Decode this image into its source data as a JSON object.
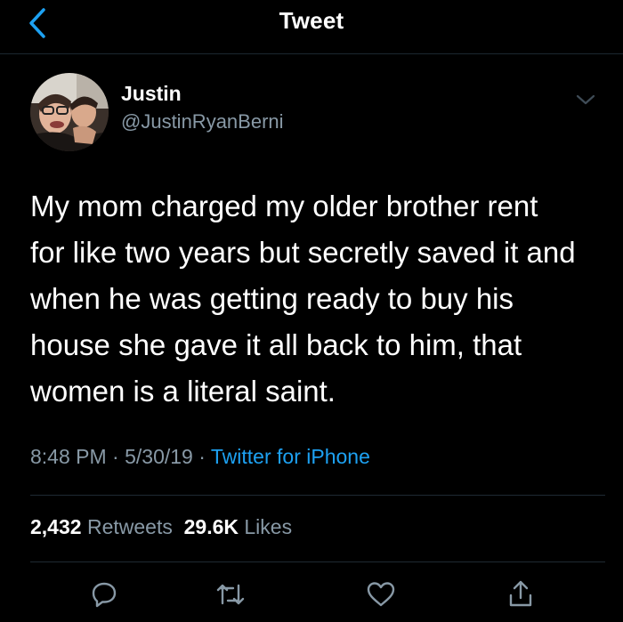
{
  "header": {
    "title": "Tweet",
    "back_icon": "chevron-left-icon"
  },
  "tweet": {
    "author": {
      "name": "Justin",
      "handle": "@JustinRyanBerni"
    },
    "lines": [
      "My mom charged my older brother rent",
      "for like two years but secretly saved it and",
      "when he was getting ready to buy his",
      "house she gave it all back to him, that",
      "women is a literal saint."
    ],
    "time": "8:48 PM",
    "date": "5/30/19",
    "separator": "·",
    "source": "Twitter for iPhone"
  },
  "stats": {
    "retweets_count": "2,432",
    "retweets_label": "Retweets",
    "likes_count": "29.6K",
    "likes_label": "Likes"
  },
  "actions": [
    "reply-icon",
    "retweet-icon",
    "like-icon",
    "share-icon"
  ],
  "colors": {
    "background": "#000000",
    "text": "#ffffff",
    "secondary": "#8899a6",
    "accent": "#1da1f2",
    "divider": "#1f2a33"
  }
}
